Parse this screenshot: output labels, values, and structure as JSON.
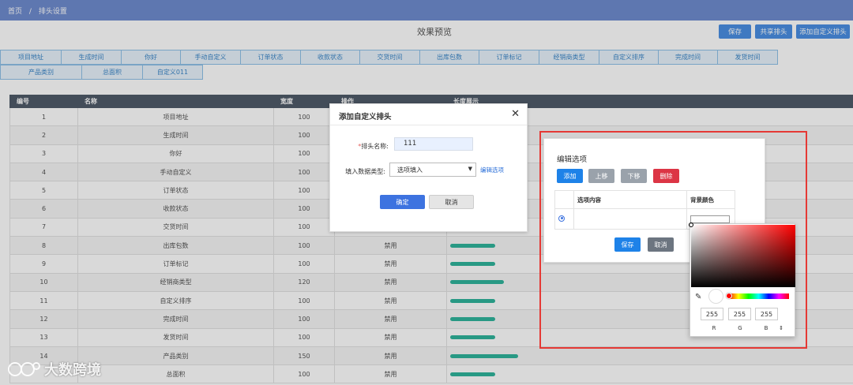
{
  "breadcrumb": {
    "home": "首页",
    "sep": "/",
    "current": "排头设置"
  },
  "preview": {
    "title": "效果预览"
  },
  "toolbar": {
    "save": "保存",
    "share": "共享排头",
    "add_custom": "添加自定义排头"
  },
  "preview_headers_row1": [
    "项目地址",
    "生成时间",
    "你好",
    "手动自定义",
    "订单状态",
    "收款状态",
    "交货时间",
    "出库包数",
    "订单标记",
    "经销商类型",
    "自定义排序",
    "完成时间",
    "发货时间"
  ],
  "preview_headers_row2": [
    "产品类别",
    "总面积",
    "自定义011"
  ],
  "table": {
    "columns": {
      "no": "编号",
      "name": "名称",
      "width": "宽度",
      "action": "操作",
      "length": "长度展示"
    },
    "rows": [
      {
        "no": "1",
        "name": "项目地址",
        "width": "100",
        "action": "",
        "bar": 0
      },
      {
        "no": "2",
        "name": "生成时间",
        "width": "100",
        "action": "",
        "bar": 0
      },
      {
        "no": "3",
        "name": "你好",
        "width": "100",
        "action": "",
        "bar": 0
      },
      {
        "no": "4",
        "name": "手动自定义",
        "width": "100",
        "action": "",
        "bar": 0
      },
      {
        "no": "5",
        "name": "订单状态",
        "width": "100",
        "action": "",
        "bar": 0
      },
      {
        "no": "6",
        "name": "收款状态",
        "width": "100",
        "action": "",
        "bar": 0
      },
      {
        "no": "7",
        "name": "交货时间",
        "width": "100",
        "action": "",
        "bar": 0
      },
      {
        "no": "8",
        "name": "出库包数",
        "width": "100",
        "action": "禁用",
        "bar": 100
      },
      {
        "no": "9",
        "name": "订单标记",
        "width": "100",
        "action": "禁用",
        "bar": 100
      },
      {
        "no": "10",
        "name": "经销商类型",
        "width": "120",
        "action": "禁用",
        "bar": 120
      },
      {
        "no": "11",
        "name": "自定义排序",
        "width": "100",
        "action": "禁用",
        "bar": 100
      },
      {
        "no": "12",
        "name": "完成时间",
        "width": "100",
        "action": "禁用",
        "bar": 100
      },
      {
        "no": "13",
        "name": "发货时间",
        "width": "100",
        "action": "禁用",
        "bar": 100
      },
      {
        "no": "14",
        "name": "产品类别",
        "width": "150",
        "action": "禁用",
        "bar": 150
      },
      {
        "no": "",
        "name": "总面积",
        "width": "100",
        "action": "禁用",
        "bar": 100
      }
    ]
  },
  "add_dialog": {
    "title": "添加自定义排头",
    "name_required_mark": "*",
    "name_label": "排头名称:",
    "name_value": "111",
    "type_label": "填入数据类型:",
    "type_value": "选项填入",
    "edit_options_link": "编辑选项",
    "confirm": "确定",
    "cancel": "取消"
  },
  "edit_dialog": {
    "title": "编辑选项",
    "add": "添加",
    "up": "上移",
    "down": "下移",
    "delete": "删除",
    "col_content": "选项内容",
    "col_bg": "背景颜色",
    "save": "保存",
    "cancel": "取消"
  },
  "color_picker": {
    "r": "255",
    "g": "255",
    "b": "255",
    "r_label": "R",
    "g_label": "G",
    "b_label": "B",
    "mode_toggle": "⇕"
  },
  "watermark": {
    "text": "大数跨境"
  },
  "colors": {
    "topbar": "#6f8ccf",
    "primary": "#4a8fe3",
    "danger": "#e53935",
    "bar": "#2fb49c"
  }
}
